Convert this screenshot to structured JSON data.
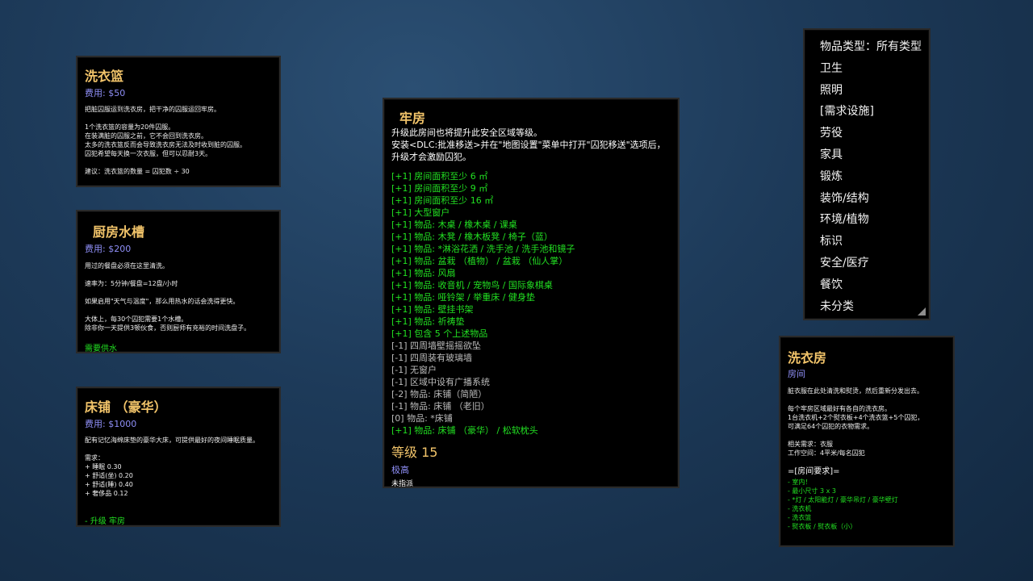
{
  "basket": {
    "title": "洗衣篮",
    "cost": "费用: $50",
    "desc": [
      "把脏囚服运到洗衣房，把干净的囚服运回牢房。",
      "",
      "1个洗衣篮的容量为20件囚服。",
      "在装满脏的囚服之前，它不会回到洗衣房。",
      "太多的洗衣篮反而会导致洗衣房无法及时收到脏的囚服。",
      "囚犯希望每天换一次衣服，但可以忍耐3天。",
      "",
      "建议：洗衣篮的数量 = 囚犯数 ÷ 30"
    ]
  },
  "sink": {
    "title": "厨房水槽",
    "cost": "费用: $200",
    "desc": [
      "用过的餐盘必须在这里清洗。",
      "",
      "速率为：5分钟/餐盘=12盘/小时",
      "",
      "如果启用\"天气与温度\"，那么用热水的话会洗得更快。",
      "",
      "大体上，每30个囚犯需要1个水槽。",
      "除非你一天提供3顿伙食，否则厨师有充裕的时间洗盘子。"
    ],
    "note": "需要供水"
  },
  "bed": {
    "title": "床铺 （豪华）",
    "cost": "费用: $1000",
    "desc": [
      "配有记忆海绵床垫的豪华大床，可提供最好的夜间睡眠质量。",
      "",
      "需求：",
      "+ 睡眠 0.30",
      "+ 舒适(坐) 0.20",
      "+ 舒适(睡) 0.40",
      "+ 奢侈品 0.12"
    ],
    "note": "- 升级  牢房"
  },
  "cell": {
    "title": "牢房",
    "intro": [
      "升级此房间也将提升此安全区域等级。",
      "安装<DLC:批准移送>并在\"地图设置\"菜单中打开\"囚犯移送\"选项后，",
      "升级才会激励囚犯。"
    ],
    "reqs": [
      {
        "text": "[+1] 房间面积至少 6 ㎡",
        "pos": true
      },
      {
        "text": "[+1] 房间面积至少 9 ㎡",
        "pos": true
      },
      {
        "text": "[+1] 房间面积至少 16 ㎡",
        "pos": true
      },
      {
        "text": "[+1]  大型窗户",
        "pos": true
      },
      {
        "text": "[+1] 物品:  木桌 / 橡木桌 / 课桌",
        "pos": true
      },
      {
        "text": "[+1] 物品:   木凳 /  橡木板凳 / 椅子（蓝）",
        "pos": true
      },
      {
        "text": "[+1] 物品:  *淋浴花洒 /  洗手池 /  洗手池和镜子",
        "pos": true
      },
      {
        "text": "[+1] 物品:   盆栽 （植物） /  盆栽 （仙人掌）",
        "pos": true
      },
      {
        "text": "[+1] 物品: 风扇",
        "pos": true
      },
      {
        "text": "[+1] 物品:   收音机 / 宠物鸟 / 国际象棋桌",
        "pos": true
      },
      {
        "text": "[+1] 物品: 哑铃架 / 举重床 /  健身垫",
        "pos": true
      },
      {
        "text": "[+1] 物品: 壁挂书架",
        "pos": true
      },
      {
        "text": "[+1] 物品: 祈祷垫",
        "pos": true
      },
      {
        "text": "[+1] 包含 5 个上述物品",
        "pos": true
      },
      {
        "text": "[-1] 四周墙壁摇摇欲坠",
        "pos": false
      },
      {
        "text": "[-1] 四周装有玻璃墙",
        "pos": false
      },
      {
        "text": "[-1] 无窗户",
        "pos": false
      },
      {
        "text": "[-1] 区域中设有广播系统",
        "pos": false
      },
      {
        "text": "[-2] 物品:   床铺（简陋）",
        "pos": false
      },
      {
        "text": "[-1] 物品:  床铺 （老旧）",
        "pos": false
      },
      {
        "text": "[0] 物品: *床铺",
        "pos": false
      },
      {
        "text": "[+1] 物品:  床铺 （豪华） / 松软枕头",
        "pos": true
      }
    ],
    "grade": "等级 15",
    "grade_label": "极高",
    "grade_sub": "未指派"
  },
  "categories": [
    "物品类型：所有类型",
    "卫生",
    "照明",
    "[需求设施]",
    "劳役",
    "家具",
    "锻炼",
    "装饰/结构",
    "环境/植物",
    "标识",
    "安全/医疗",
    "餐饮",
    "未分类"
  ],
  "laundry": {
    "title": "洗衣房",
    "subtitle": "房间",
    "desc": [
      "脏衣服在此处清洗和熨烫，然后重新分发出去。",
      "",
      "每个牢房区域最好有各自的洗衣房。",
      "1台洗衣机+2个熨衣板+4个洗衣篮+5个囚犯，",
      "可满足64个囚犯的衣物需求。",
      "",
      "相关需求：衣服",
      "工作空间：4平米/每名囚犯"
    ],
    "req_title": "=[房间要求]=",
    "reqs": [
      "- 室内！",
      "- 最小尺寸 3 x 3",
      "-  *灯 /  太阳能灯 /  豪华吊灯 /   豪华壁灯",
      "- 洗衣机",
      "- 洗衣篮",
      "- 熨衣板 / 熨衣板（小）"
    ]
  },
  "colors": {
    "title": "#f2c46a",
    "cost": "#8f8ff7",
    "positive": "#22e022",
    "negative": "#bcbcbc",
    "panel": "#000000"
  }
}
